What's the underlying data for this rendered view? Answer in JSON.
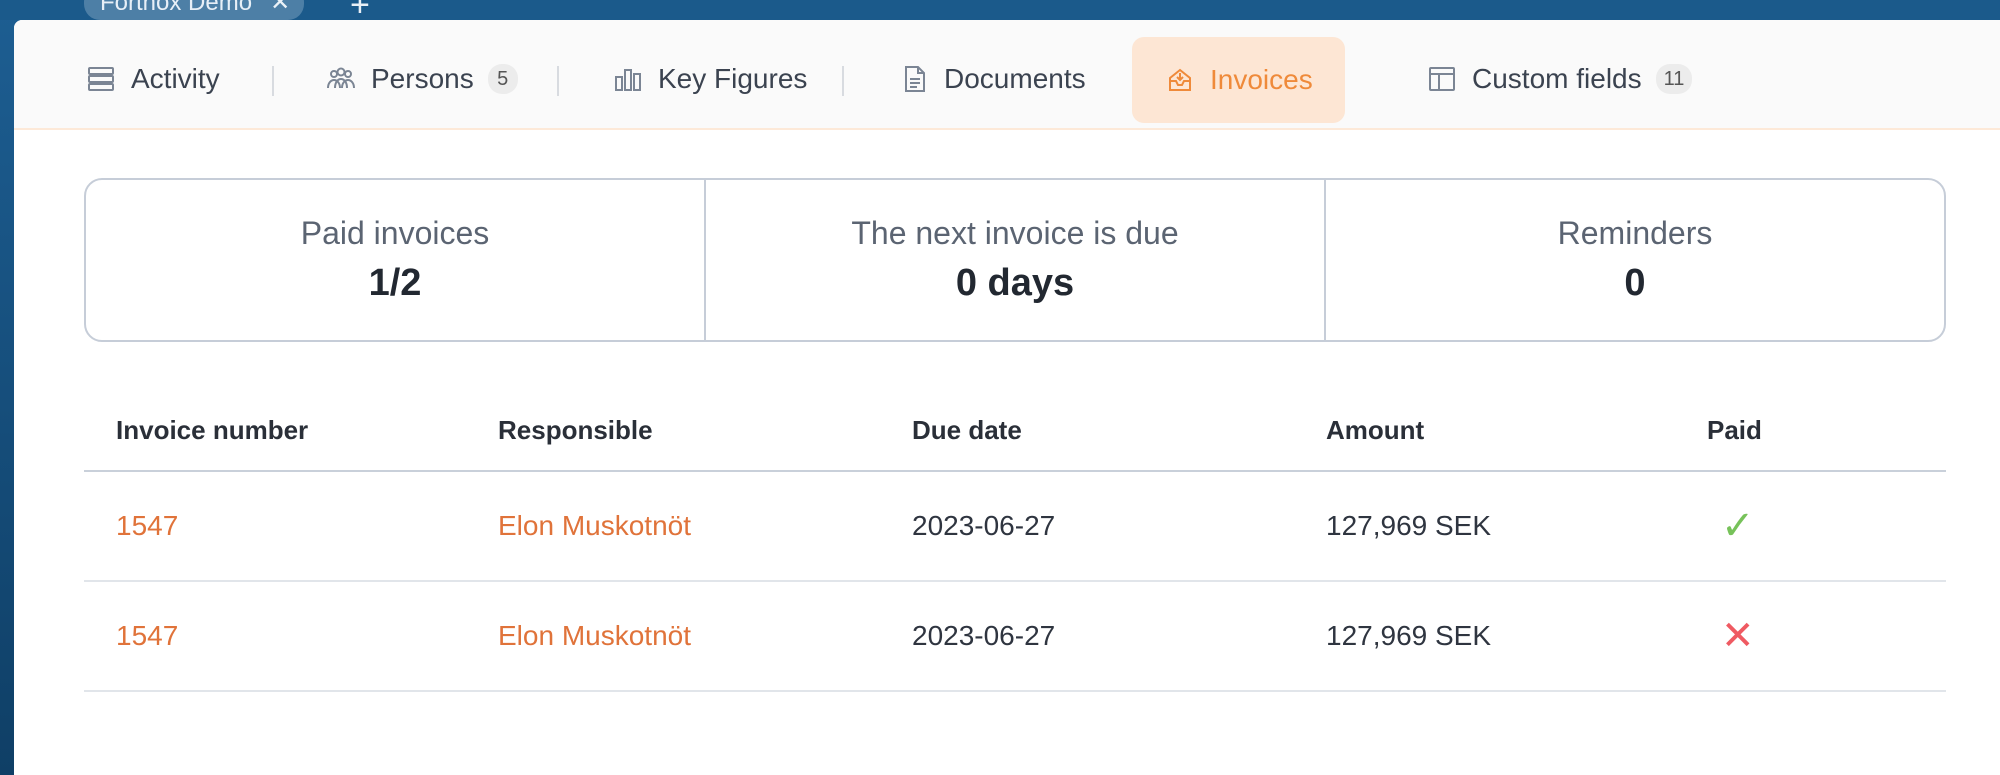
{
  "window": {
    "tab_title": "Fortnox Demo",
    "close_glyph": "✕",
    "add_glyph": "+"
  },
  "tabs": [
    {
      "label": "Activity",
      "icon": "stack-icon",
      "badge": null
    },
    {
      "label": "Persons",
      "icon": "people-icon",
      "badge": "5"
    },
    {
      "label": "Key Figures",
      "icon": "bar-chart-icon",
      "badge": null
    },
    {
      "label": "Documents",
      "icon": "document-icon",
      "badge": null
    },
    {
      "label": "Invoices",
      "icon": "inbox-icon",
      "badge": null,
      "active": true
    },
    {
      "label": "Custom fields",
      "icon": "table-icon",
      "badge": "11"
    }
  ],
  "stats": [
    {
      "label": "Paid invoices",
      "value": "1/2"
    },
    {
      "label": "The next invoice is due",
      "value": "0 days"
    },
    {
      "label": "Reminders",
      "value": "0"
    }
  ],
  "table": {
    "headers": [
      "Invoice number",
      "Responsible",
      "Due date",
      "Amount",
      "Paid"
    ],
    "rows": [
      {
        "invoice": "1547",
        "responsible": "Elon Muskotnöt",
        "due": "2023-06-27",
        "amount": "127,969 SEK",
        "paid": true,
        "paid_glyph": "✓"
      },
      {
        "invoice": "1547",
        "responsible": "Elon Muskotnöt",
        "due": "2023-06-27",
        "amount": "127,969 SEK",
        "paid": false,
        "paid_glyph": "✕"
      }
    ]
  },
  "colors": {
    "accent": "#ef8a3a",
    "link": "#e0733a",
    "ok": "#77c25a",
    "bad": "#ef5a62"
  }
}
